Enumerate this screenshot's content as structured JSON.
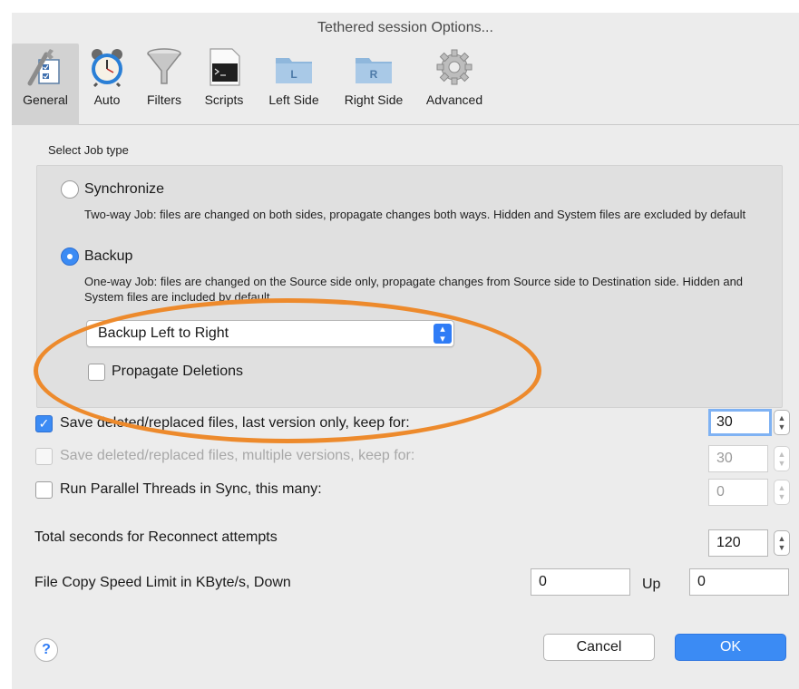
{
  "window": {
    "title": "Tethered session Options..."
  },
  "toolbar": {
    "items": [
      {
        "label": "General",
        "icon": "general-wrench-checkbox-icon",
        "selected": true
      },
      {
        "label": "Auto",
        "icon": "alarm-clock-icon"
      },
      {
        "label": "Filters",
        "icon": "funnel-icon"
      },
      {
        "label": "Scripts",
        "icon": "terminal-document-icon"
      },
      {
        "label": "Left Side",
        "icon": "folder-l-icon"
      },
      {
        "label": "Right Side",
        "icon": "folder-r-icon"
      },
      {
        "label": "Advanced",
        "icon": "gear-icon"
      }
    ]
  },
  "job_type": {
    "label": "Select Job type",
    "options": [
      {
        "label": "Synchronize",
        "selected": false,
        "description": "Two-way Job: files are changed on both sides, propagate changes both ways.  Hidden and System files are excluded by default"
      },
      {
        "label": "Backup",
        "selected": true,
        "description": "One-way Job: files are changed on the Source side only, propagate changes from Source side to Destination side. Hidden and System files are included by default"
      }
    ],
    "direction": {
      "value": "Backup Left to Right"
    },
    "propagate_deletions": {
      "label": "Propagate Deletions",
      "checked": false
    }
  },
  "options": {
    "save_last_version": {
      "label": "Save deleted/replaced files, last version only, keep for:",
      "checked": true,
      "value": "30"
    },
    "save_multiple_versions": {
      "label": "Save deleted/replaced files, multiple versions, keep for:",
      "checked": false,
      "disabled": true,
      "value": "30"
    },
    "parallel_threads": {
      "label": "Run Parallel Threads in Sync, this many:",
      "checked": false,
      "value": "0"
    },
    "reconnect": {
      "label": "Total seconds for Reconnect attempts",
      "value": "120"
    },
    "speed_limit": {
      "label": "File Copy Speed Limit in KByte/s, Down",
      "down_value": "0",
      "up_label": "Up",
      "up_value": "0"
    }
  },
  "buttons": {
    "help": "?",
    "cancel": "Cancel",
    "ok": "OK"
  },
  "colors": {
    "accent": "#3b8bf4",
    "highlight": "#ed8a2c",
    "panel": "#ececec"
  }
}
